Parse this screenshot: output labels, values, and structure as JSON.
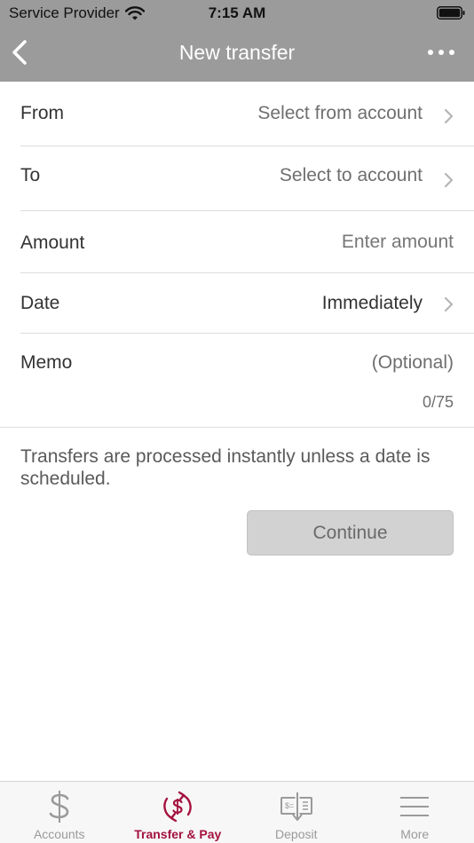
{
  "status_bar": {
    "carrier": "Service Provider",
    "time": "7:15 AM"
  },
  "navbar": {
    "title": "New transfer"
  },
  "form": {
    "from": {
      "label": "From",
      "value": "Select from account"
    },
    "to": {
      "label": "To",
      "value": "Select to account"
    },
    "amount": {
      "label": "Amount",
      "placeholder": "Enter amount"
    },
    "date": {
      "label": "Date",
      "value": "Immediately"
    },
    "memo": {
      "label": "Memo",
      "placeholder": "(Optional)",
      "counter": "0/75"
    }
  },
  "info_text": "Transfers are processed instantly unless a date is scheduled.",
  "continue_label": "Continue",
  "tabs": [
    {
      "label": "Accounts",
      "icon": "dollar-icon",
      "active": false
    },
    {
      "label": "Transfer & Pay",
      "icon": "transfer-pay-icon",
      "active": true
    },
    {
      "label": "Deposit",
      "icon": "check-deposit-icon",
      "active": false
    },
    {
      "label": "More",
      "icon": "menu-icon",
      "active": false
    }
  ],
  "colors": {
    "header": "#9b9b9b",
    "accent": "#a4123f",
    "button": "#d2d2d2"
  }
}
